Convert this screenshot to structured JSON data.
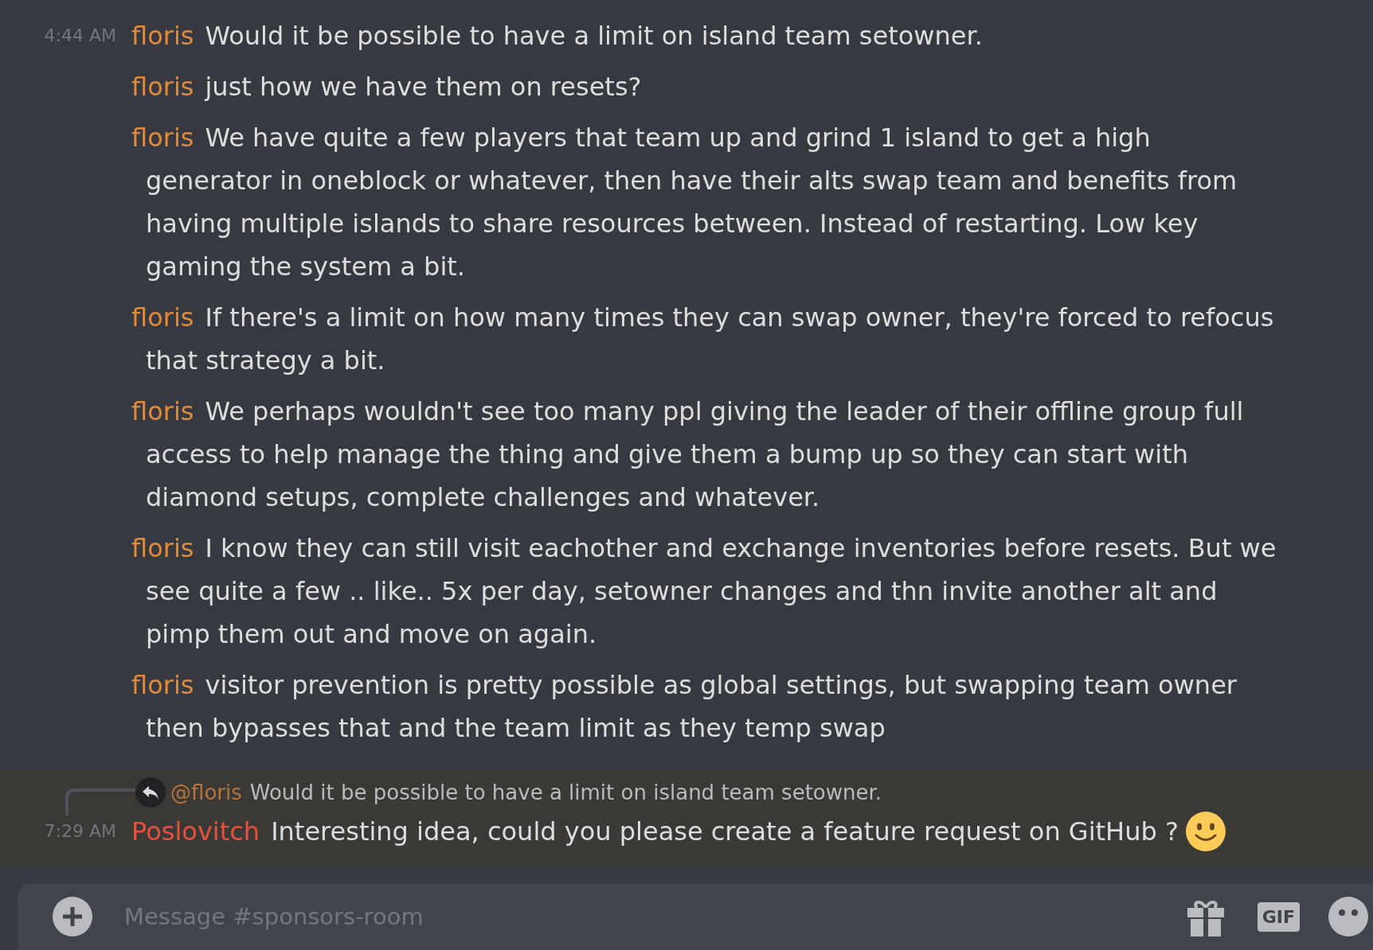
{
  "messages": [
    {
      "timestamp": "4:44 AM",
      "author": "floris",
      "color": "#e08a3c",
      "text": "Would it be possible to have a limit on island team setowner."
    },
    {
      "author": "floris",
      "color": "#e08a3c",
      "text": "just how we have them on resets?"
    },
    {
      "author": "floris",
      "color": "#e08a3c",
      "text": "We have quite a few players that team up and grind 1 island to get a high generator in oneblock or whatever, then have their alts swap team and benefits from having multiple islands to share resources between. Instead of restarting. Low key gaming the system a bit."
    },
    {
      "author": "floris",
      "color": "#e08a3c",
      "text": "If there's a limit on how many times they can swap owner, they're forced to refocus that strategy a bit."
    },
    {
      "author": "floris",
      "color": "#e08a3c",
      "text": "We perhaps wouldn't see too many ppl giving the leader of their offline group full access to help manage the thing and give them a bump up so they can start with diamond setups, complete challenges and whatever."
    },
    {
      "author": "floris",
      "color": "#e08a3c",
      "text": "I know they can still visit eachother and exchange inventories before resets. But we see quite a few .. like.. 5x per day, setowner changes and thn invite another alt and pimp them out and move on again."
    },
    {
      "author": "floris",
      "color": "#e08a3c",
      "text": "visitor prevention is pretty possible as global settings, but swapping team owner then bypasses that and the team limit as they temp swap"
    },
    {
      "timestamp": "7:29 AM",
      "author": "Poslovitch",
      "color": "#e8503e",
      "text": "Interesting idea, could you please create a feature request on GitHub ?",
      "trailing_emoji": true,
      "reply": {
        "mention": "@floris",
        "text": "Would it be possible to have a limit on island team setowner."
      }
    }
  ],
  "composer": {
    "placeholder": "Message #sponsors-room",
    "gif_label": "GIF"
  }
}
